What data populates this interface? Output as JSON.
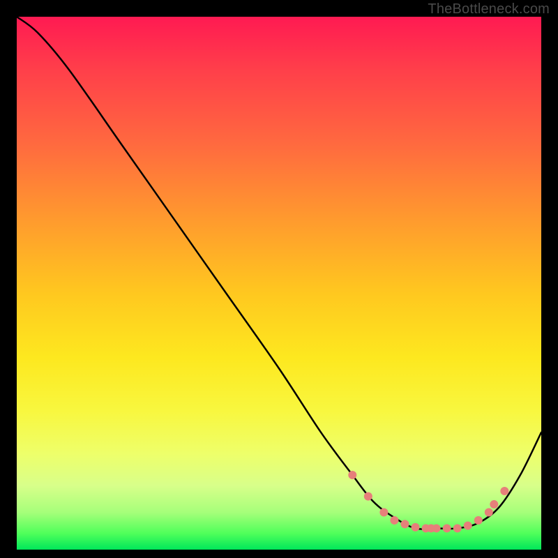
{
  "watermark": "TheBottleneck.com",
  "chart_data": {
    "type": "line",
    "title": "",
    "xlabel": "",
    "ylabel": "",
    "xlim": [
      0,
      100
    ],
    "ylim": [
      0,
      100
    ],
    "grid": false,
    "series": [
      {
        "name": "curve",
        "color": "#000000",
        "x": [
          0,
          4,
          10,
          20,
          30,
          40,
          50,
          58,
          64,
          68,
          72,
          76,
          80,
          84,
          88,
          92,
          96,
          100
        ],
        "y": [
          100,
          97,
          90,
          76,
          62,
          48,
          34,
          22,
          14,
          9,
          6,
          4,
          4,
          4,
          5,
          8,
          14,
          22
        ]
      }
    ],
    "markers": {
      "color": "#e6807a",
      "radius_px": 6,
      "points": [
        {
          "x": 64,
          "y": 14
        },
        {
          "x": 67,
          "y": 10
        },
        {
          "x": 70,
          "y": 7
        },
        {
          "x": 72,
          "y": 5.5
        },
        {
          "x": 74,
          "y": 4.8
        },
        {
          "x": 76,
          "y": 4.2
        },
        {
          "x": 78,
          "y": 4.0
        },
        {
          "x": 79,
          "y": 4.0
        },
        {
          "x": 80,
          "y": 4.0
        },
        {
          "x": 82,
          "y": 4.0
        },
        {
          "x": 84,
          "y": 4.0
        },
        {
          "x": 86,
          "y": 4.5
        },
        {
          "x": 88,
          "y": 5.5
        },
        {
          "x": 90,
          "y": 7.0
        },
        {
          "x": 91,
          "y": 8.5
        },
        {
          "x": 93,
          "y": 11.0
        }
      ]
    }
  }
}
